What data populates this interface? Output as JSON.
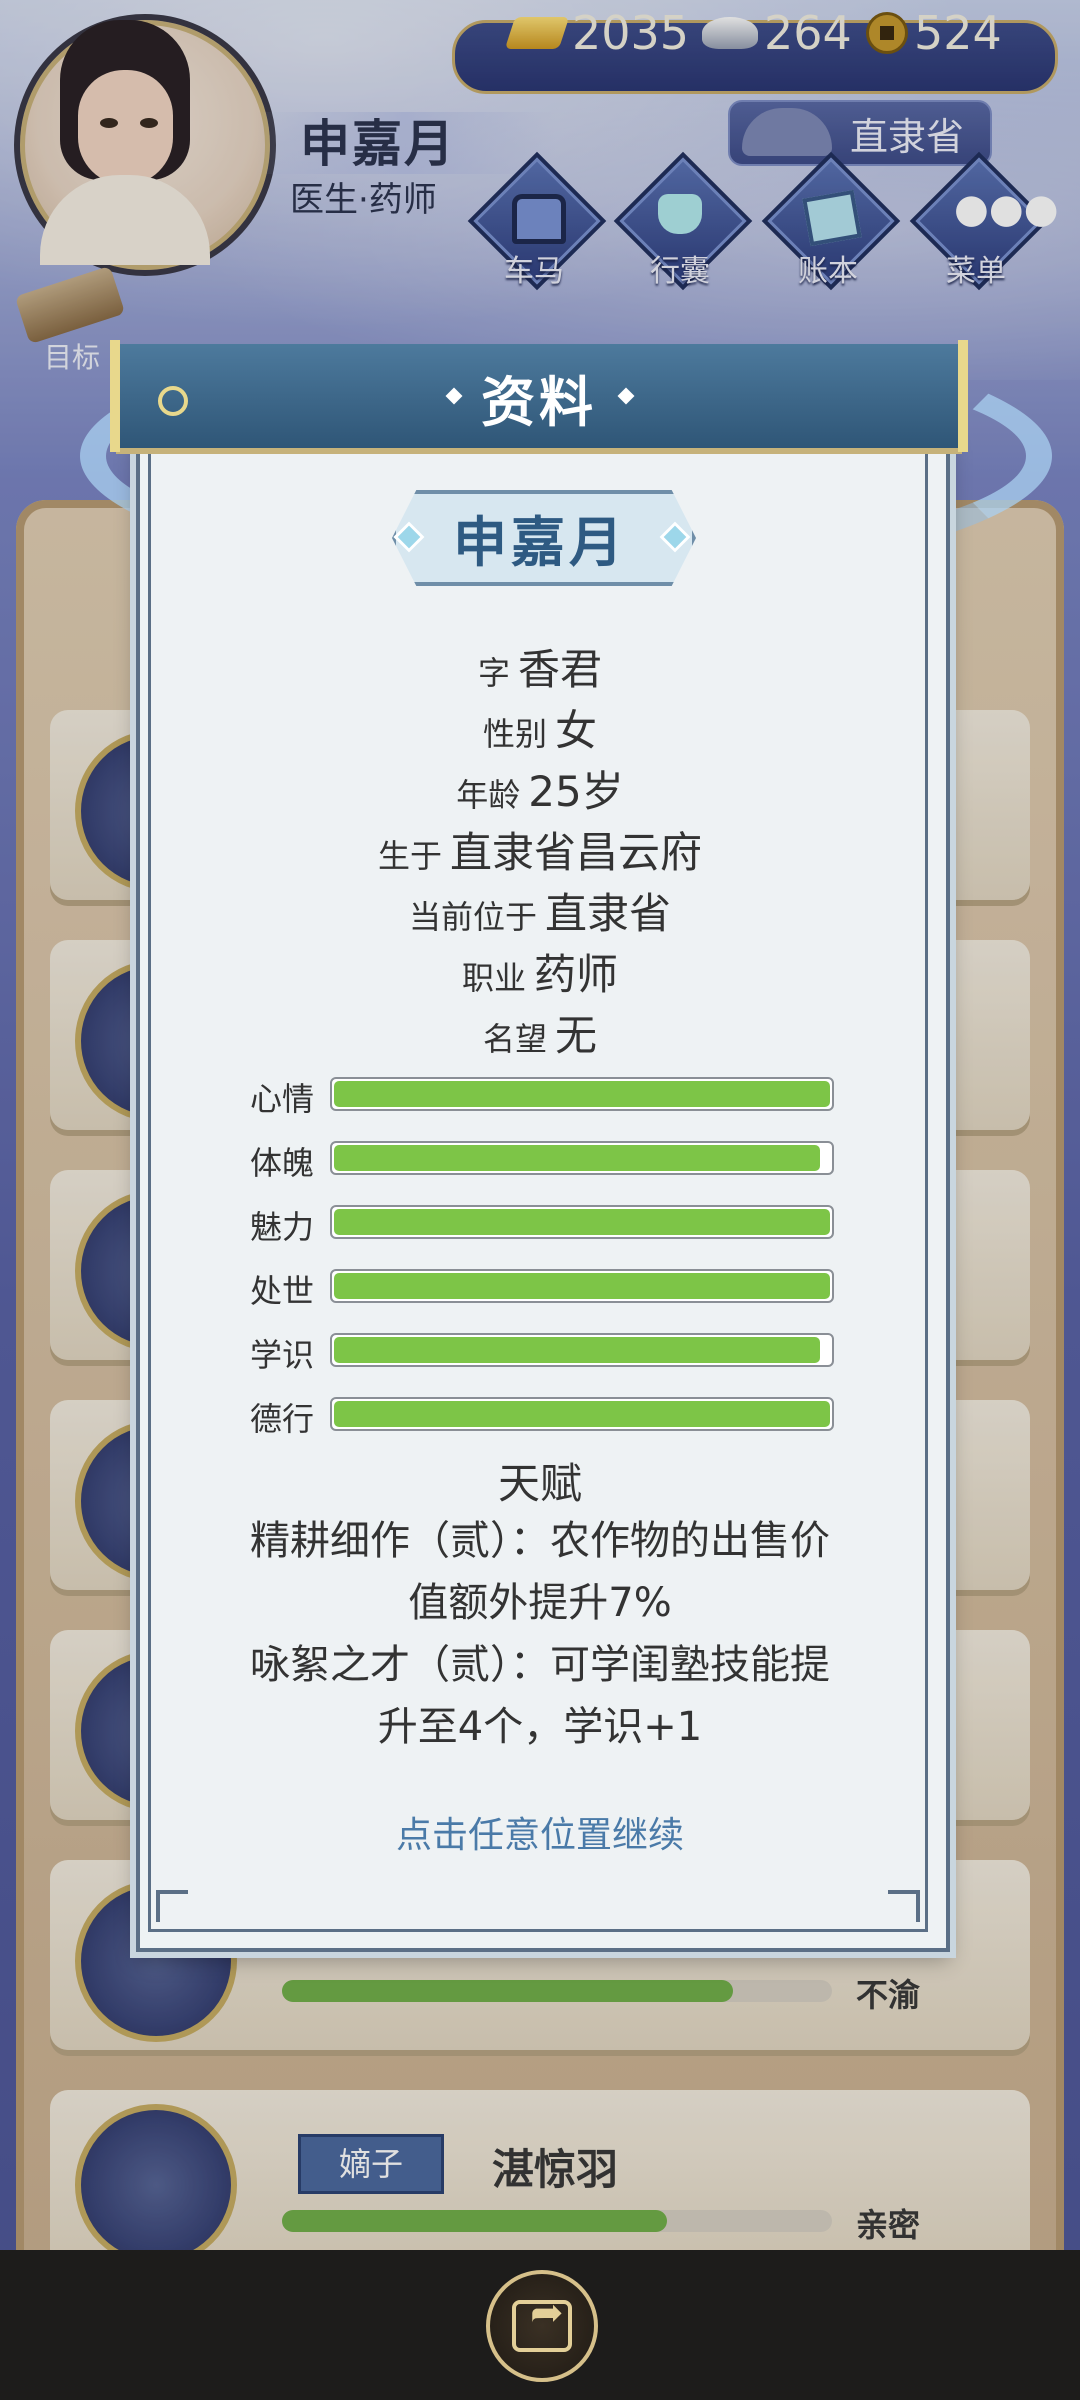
{
  "hud": {
    "player_name": "申嘉月",
    "player_title": "医生·药师",
    "location": "直隶省",
    "currency": {
      "gold": "2035",
      "silver": "264",
      "coins": "524"
    },
    "buttons": {
      "carriage": "车马",
      "bag": "行囊",
      "ledger": "账本",
      "menu": "菜单"
    },
    "goal": "目标"
  },
  "background_list": {
    "cards": [
      {
        "rank": "",
        "name": "",
        "relation": "不渝",
        "relation_level": 0.82
      },
      {
        "rank": "嫡子",
        "name": "湛惊羽",
        "relation": "亲密",
        "relation_level": 0.7
      }
    ]
  },
  "dialog": {
    "title": "资料",
    "name": "申嘉月",
    "info": [
      {
        "key": "字",
        "value": "香君"
      },
      {
        "key": "性别",
        "value": "女"
      },
      {
        "key": "年龄",
        "value": "25岁"
      },
      {
        "key": "生于",
        "value": "直隶省昌云府"
      },
      {
        "key": "当前位于",
        "value": "直隶省"
      },
      {
        "key": "职业",
        "value": "药师"
      },
      {
        "key": "名望",
        "value": "无"
      }
    ],
    "stats": [
      {
        "label": "心情",
        "value": 1.0
      },
      {
        "label": "体魄",
        "value": 0.98
      },
      {
        "label": "魅力",
        "value": 1.0
      },
      {
        "label": "处世",
        "value": 1.0
      },
      {
        "label": "学识",
        "value": 0.98
      },
      {
        "label": "德行",
        "value": 1.0
      }
    ],
    "talent_title": "天赋",
    "talent_lines": [
      "精耕细作（贰）：农作物的出售价",
      "值额外提升7%",
      "咏絮之才（贰）：可学闺塾技能提",
      "升至4个，学识+1"
    ],
    "continue_hint": "点击任意位置继续"
  },
  "colors": {
    "stat_fill": "#7dc547",
    "header": "#2f5677",
    "hint": "#4a7aa8"
  },
  "icons": [
    "share-icon",
    "carriage-icon",
    "bag-icon",
    "ledger-icon",
    "menu-icon"
  ]
}
